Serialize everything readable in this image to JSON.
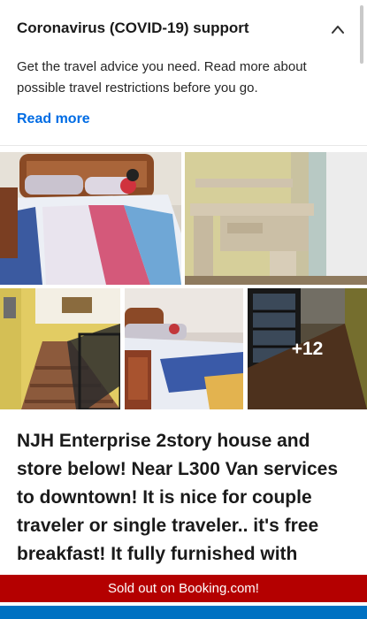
{
  "covid_banner": {
    "title": "Coronavirus (COVID-19) support",
    "body": "Get the travel advice you need. Read more about possible travel restrictions before you go.",
    "link_label": "Read more",
    "collapse_icon": "chevron-up-icon"
  },
  "gallery": {
    "photos": [
      {
        "subject": "bedroom-bed"
      },
      {
        "subject": "wooden-desk"
      },
      {
        "subject": "staircase"
      },
      {
        "subject": "bed-with-chair"
      },
      {
        "subject": "hallway-floor"
      }
    ],
    "more_count_label": "+12"
  },
  "property": {
    "title": "NJH Enterprise 2story house and store below! Near L300 Van services to downtown! It is nice for couple traveler or single traveler.. it's free breakfast! It fully furnished with"
  },
  "availability": {
    "status_text": "Sold out on Booking.com!",
    "status_color": "#b40000"
  },
  "colors": {
    "accent": "#006ce4",
    "cta": "#0071c2"
  }
}
